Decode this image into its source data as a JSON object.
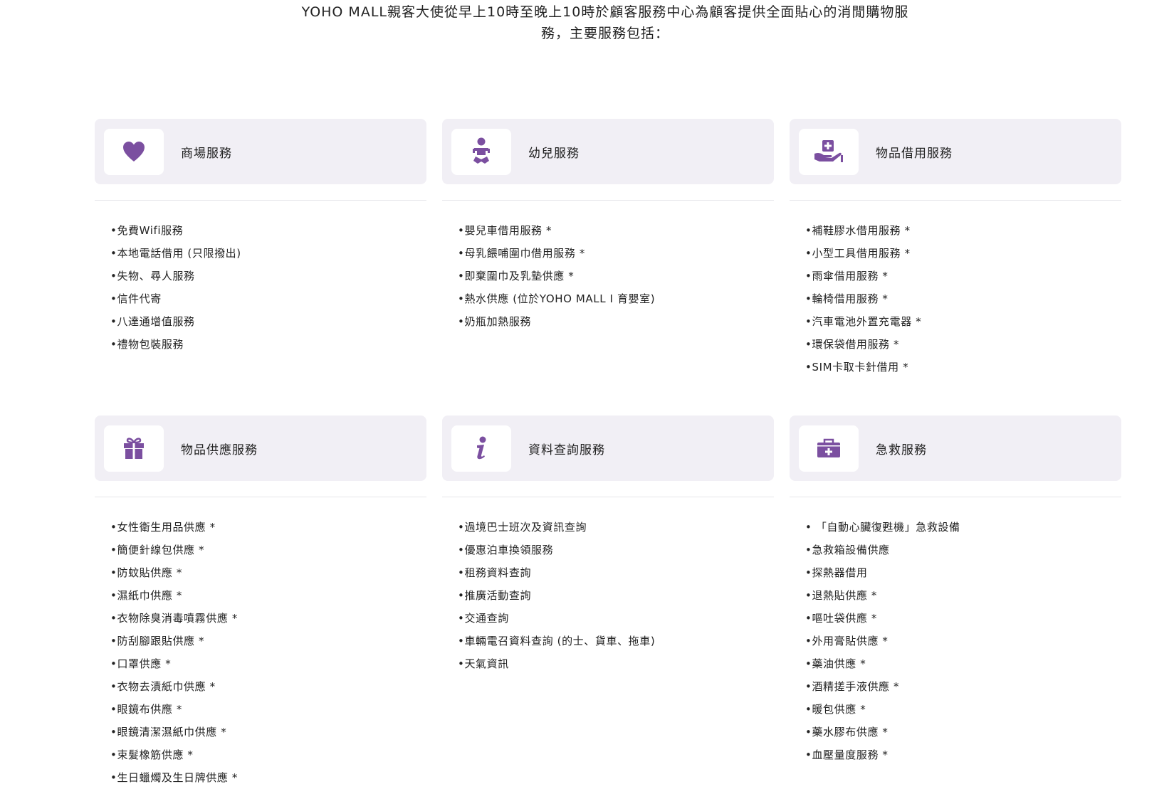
{
  "intro": {
    "line1": "YOHO MALL親客大使從早上10時至晚上10時於顧客服務中心為顧客提供全面貼心的消閒購物服",
    "line2": "務，主要服務包括："
  },
  "colors": {
    "accent": "#7b4fa0",
    "header_bg": "#f1eff5"
  },
  "cards": [
    {
      "title": "商場服務",
      "icon": "heart-icon",
      "items": [
        "免費Wifi服務",
        "本地電話借用 (只限撥出)",
        "失物、尋人服務",
        "信件代寄",
        "八達通增值服務",
        "禮物包裝服務"
      ]
    },
    {
      "title": "幼兒服務",
      "icon": "baby-icon",
      "items": [
        "嬰兒車借用服務 *",
        "母乳餵哺圍巾借用服務 *",
        "即棄圍巾及乳墊供應 *",
        "熱水供應 (位於YOHO MALL I 育嬰室)",
        "奶瓶加熱服務"
      ]
    },
    {
      "title": "物品借用服務",
      "icon": "hand-box-icon",
      "items": [
        "補鞋膠水借用服務 *",
        "小型工具借用服務 *",
        "雨傘借用服務 *",
        "輪椅借用服務 *",
        "汽車電池外置充電器 *",
        "環保袋借用服務 *",
        "SIM卡取卡針借用 *"
      ]
    },
    {
      "title": "物品供應服務",
      "icon": "gift-icon",
      "items": [
        "女性衛生用品供應 *",
        "簡便針線包供應 *",
        "防蚊貼供應 *",
        "濕紙巾供應 *",
        "衣物除臭消毒噴霧供應 *",
        "防刮腳跟貼供應 *",
        "口罩供應 *",
        "衣物去漬紙巾供應 *",
        "眼鏡布供應 *",
        "眼鏡清潔濕紙巾供應 *",
        "束髮橡筋供應 *",
        "生日蠟燭及生日牌供應 *"
      ]
    },
    {
      "title": "資料查詢服務",
      "icon": "info-icon",
      "items": [
        "過境巴士班次及資訊查詢",
        "優惠泊車換領服務",
        "租務資料查詢",
        "推廣活動查詢",
        "交通查詢",
        "車輛電召資料查詢 (的士、貨車、拖車)",
        "天氣資訊"
      ]
    },
    {
      "title": "急救服務",
      "icon": "first-aid-kit-icon",
      "items": [
        " 「自動心臟復甦機」急救設備",
        "急救箱設備供應",
        "探熱器借用",
        "退熱貼供應 *",
        "嘔吐袋供應 *",
        "外用膏貼供應 *",
        "藥油供應 *",
        "酒精搓手液供應 *",
        "暖包供應 *",
        "藥水膠布供應 *",
        "血壓量度服務 *"
      ]
    }
  ]
}
